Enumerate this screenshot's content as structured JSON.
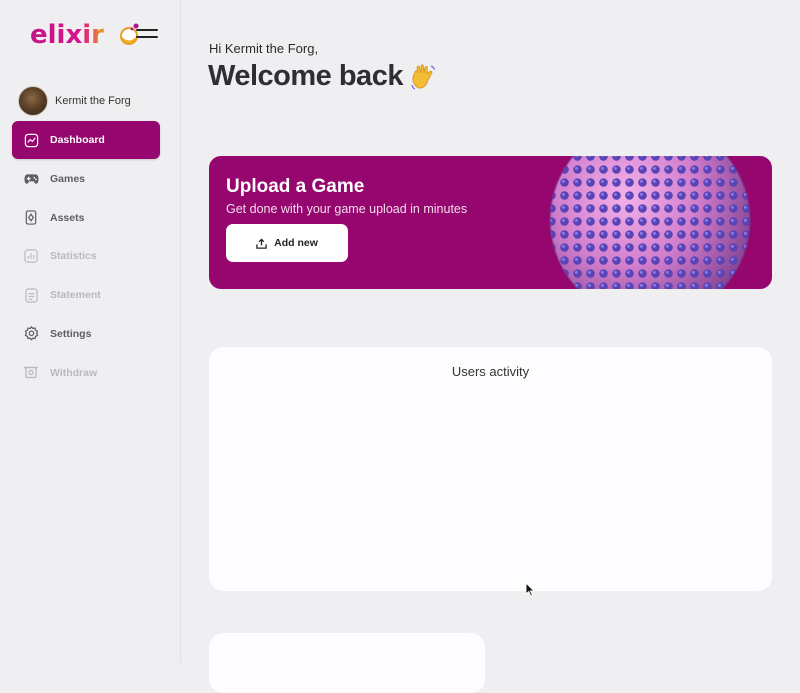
{
  "brand": {
    "name": "elixir",
    "colors": {
      "primary": "#95066f",
      "logo_gradient_start": "#c2148a",
      "logo_gradient_end": "#f0a21c"
    }
  },
  "user": {
    "name": "Kermit the Forg"
  },
  "nav": {
    "items": [
      {
        "label": "Dashboard",
        "icon": "chart-line-icon",
        "state": "active"
      },
      {
        "label": "Games",
        "icon": "gamepad-icon",
        "state": "normal"
      },
      {
        "label": "Assets",
        "icon": "asset-card-icon",
        "state": "normal"
      },
      {
        "label": "Statistics",
        "icon": "statistics-icon",
        "state": "disabled"
      },
      {
        "label": "Statement",
        "icon": "statement-icon",
        "state": "disabled"
      },
      {
        "label": "Settings",
        "icon": "gear-icon",
        "state": "normal"
      },
      {
        "label": "Withdraw",
        "icon": "withdraw-icon",
        "state": "disabled"
      }
    ]
  },
  "header": {
    "greeting": "Hi Kermit the Forg,",
    "welcome": "Welcome back",
    "welcome_icon": "waving-hand-icon"
  },
  "banner": {
    "title": "Upload a Game",
    "subtitle": "Get done with your game upload in minutes",
    "button_label": "Add new",
    "button_icon": "upload-icon"
  },
  "activity_card": {
    "title": "Users activity"
  }
}
